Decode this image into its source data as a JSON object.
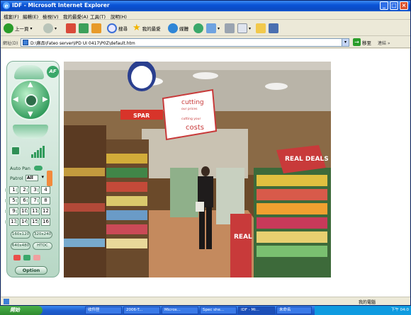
{
  "window": {
    "title": "IDF - Microsoft Internet Explorer"
  },
  "menu": {
    "items": [
      "檔案(F)",
      "編輯(E)",
      "檢視(V)",
      "我的最愛(A)",
      "工具(T)",
      "說明(H)"
    ]
  },
  "toolbar": {
    "back_label": "上一頁",
    "search_label": "搜尋",
    "favorites_label": "我的最愛",
    "media_label": "媒體"
  },
  "address": {
    "label": "網址(D)",
    "url": "D:\\廠品\\Fateo server\\IPD UI 0417\\P0Z\\default.htm",
    "go_label": "移至",
    "links_label": "連結 »"
  },
  "panel": {
    "af_label": "AF",
    "auto_pan_label": "Auto Pan",
    "patrol_label": "Patrol",
    "patrol_value": "All",
    "presets": [
      "1",
      "2",
      "3",
      "4",
      "5",
      "6",
      "7",
      "8",
      "9",
      "10",
      "11",
      "12",
      "13",
      "14",
      "15",
      "16"
    ],
    "resolutions": [
      "160x120",
      "320x240",
      "640x480",
      "HTOC"
    ],
    "option_label": "Option"
  },
  "video": {
    "signs": {
      "cutting_top": "cutting",
      "cutting_sub1": "our prices",
      "cutting_sub2": "cutting your",
      "cutting_costs": "costs",
      "spar": "SPAR",
      "real_deals": "REAL DEALS",
      "real_small": "REAL"
    }
  },
  "status": {
    "zone_label": "我的電腦"
  },
  "taskbar": {
    "start_label": "開始",
    "tasks": [
      "收件匣",
      "2006-T...",
      "Micros...",
      "Spec she...",
      "IDF - Mi...",
      "未命名"
    ],
    "clock": "下午 04:0"
  }
}
